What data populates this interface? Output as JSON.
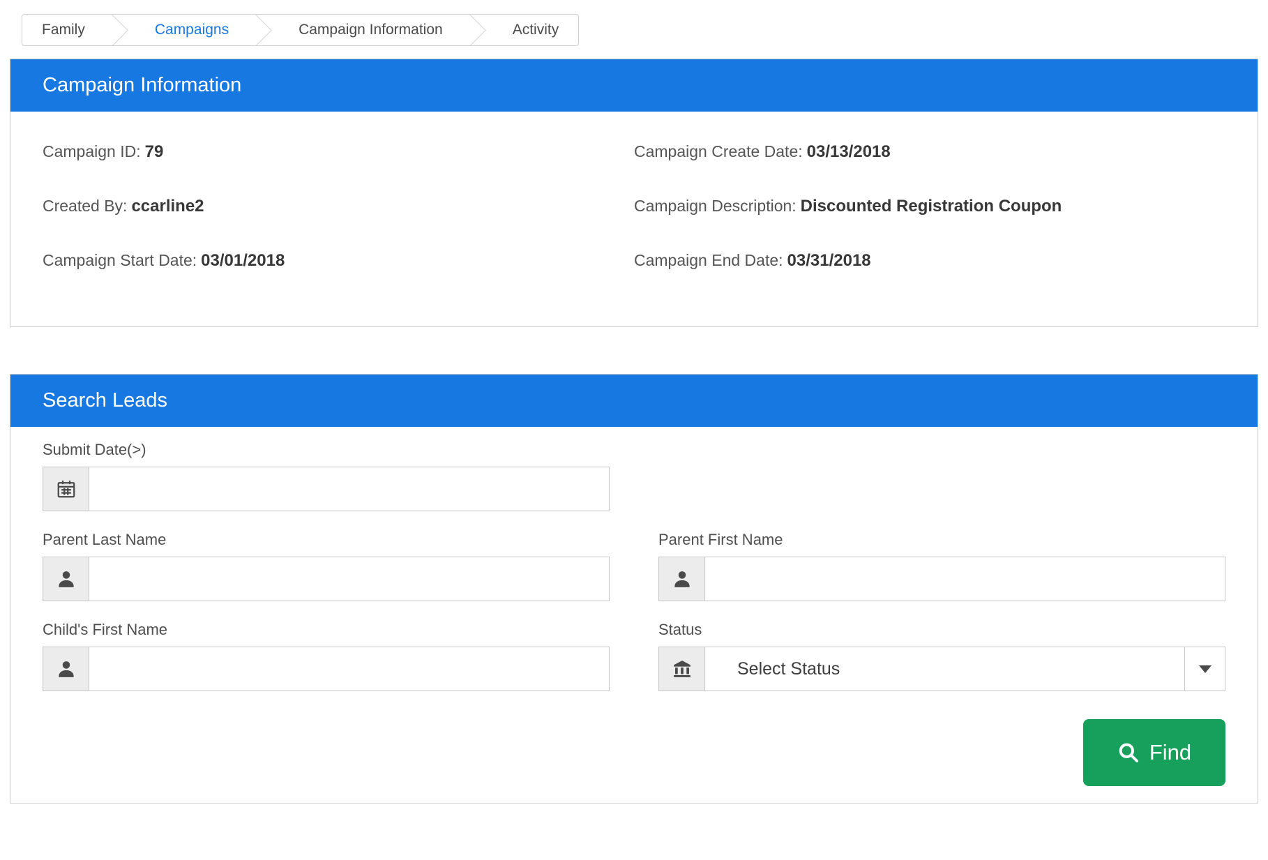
{
  "colors": {
    "header_blue": "#1778e2",
    "link_blue": "#1778e2",
    "button_green": "#17a05c"
  },
  "breadcrumb": {
    "items": [
      {
        "label": "Family",
        "active": false
      },
      {
        "label": "Campaigns",
        "active": true
      },
      {
        "label": "Campaign Information",
        "active": false
      },
      {
        "label": "Activity",
        "active": false
      }
    ]
  },
  "campaign_info": {
    "title": "Campaign Information",
    "fields": [
      {
        "label": "Campaign ID:",
        "value": "79"
      },
      {
        "label": "Campaign Create Date:",
        "value": "03/13/2018"
      },
      {
        "label": "Created By:",
        "value": "ccarline2"
      },
      {
        "label": "Campaign Description:",
        "value": "Discounted Registration Coupon"
      },
      {
        "label": "Campaign Start Date:",
        "value": "03/01/2018"
      },
      {
        "label": "Campaign End Date:",
        "value": "03/31/2018"
      }
    ]
  },
  "search_leads": {
    "title": "Search Leads",
    "submit_date": {
      "label": "Submit Date(>)",
      "value": "",
      "icon": "calendar-icon"
    },
    "parent_last_name": {
      "label": "Parent Last Name",
      "value": "",
      "icon": "person-icon"
    },
    "parent_first_name": {
      "label": "Parent First Name",
      "value": "",
      "icon": "person-icon"
    },
    "childs_first_name": {
      "label": "Child's First Name",
      "value": "",
      "icon": "person-icon"
    },
    "status": {
      "label": "Status",
      "selected": "Select Status",
      "icon": "bank-icon"
    },
    "find_button": {
      "label": "Find",
      "icon": "search-icon"
    }
  }
}
